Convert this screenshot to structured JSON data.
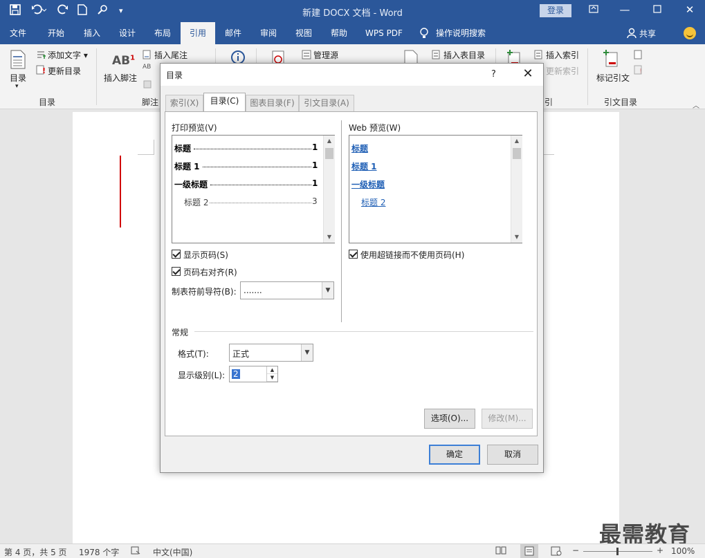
{
  "window": {
    "title": "新建 DOCX 文档  -  Word",
    "login": "登录"
  },
  "tabs": [
    "文件",
    "开始",
    "插入",
    "设计",
    "布局",
    "引用",
    "邮件",
    "审阅",
    "视图",
    "帮助",
    "WPS PDF",
    "操作说明搜索"
  ],
  "active_tab": "引用",
  "share": "共享",
  "ribbon": {
    "toc_button": "目录",
    "add_text": "添加文字",
    "update_toc": "更新目录",
    "group_toc": "目录",
    "insert_footnote": "插入脚注",
    "insert_endnote": "插入尾注",
    "group_footnote": "脚注",
    "manage_sources": "管理源",
    "insert_table_of_figures": "插入表目录",
    "insert_index": "插入索引",
    "update_index": "更新索引",
    "group_index": "引",
    "mark_citation": "标记引文",
    "group_citation": "引文目录"
  },
  "dialog": {
    "title": "目录",
    "help": "?",
    "tabs": [
      "索引(X)",
      "目录(C)",
      "图表目录(F)",
      "引文目录(A)"
    ],
    "active_tab": "目录(C)",
    "print_preview_label": "打印预览(V)",
    "web_preview_label": "Web 预览(W)",
    "print_preview": [
      {
        "text": "标题",
        "page": "1"
      },
      {
        "text": "标题  1",
        "page": "1"
      },
      {
        "text": "一级标题",
        "page": "1"
      },
      {
        "text": "标题  2",
        "page": "3"
      }
    ],
    "web_preview": [
      "标题",
      "标题  1",
      "一级标题",
      "标题  2"
    ],
    "show_page_numbers": "显示页码(S)",
    "right_align": "页码右对齐(R)",
    "use_hyperlinks": "使用超链接而不使用页码(H)",
    "tab_leader_label": "制表符前导符(B):",
    "tab_leader_value": ".......",
    "general_label": "常规",
    "format_label": "格式(T):",
    "format_value": "正式",
    "levels_label": "显示级别(L):",
    "levels_value": "2",
    "options_btn": "选项(O)...",
    "modify_btn": "修改(M)...",
    "ok_btn": "确定",
    "cancel_btn": "取消"
  },
  "statusbar": {
    "page": "第 4 页，共 5 页",
    "words": "1978 个字",
    "lang": "中文(中国)",
    "zoom": "100%"
  },
  "watermark": "最需教育"
}
